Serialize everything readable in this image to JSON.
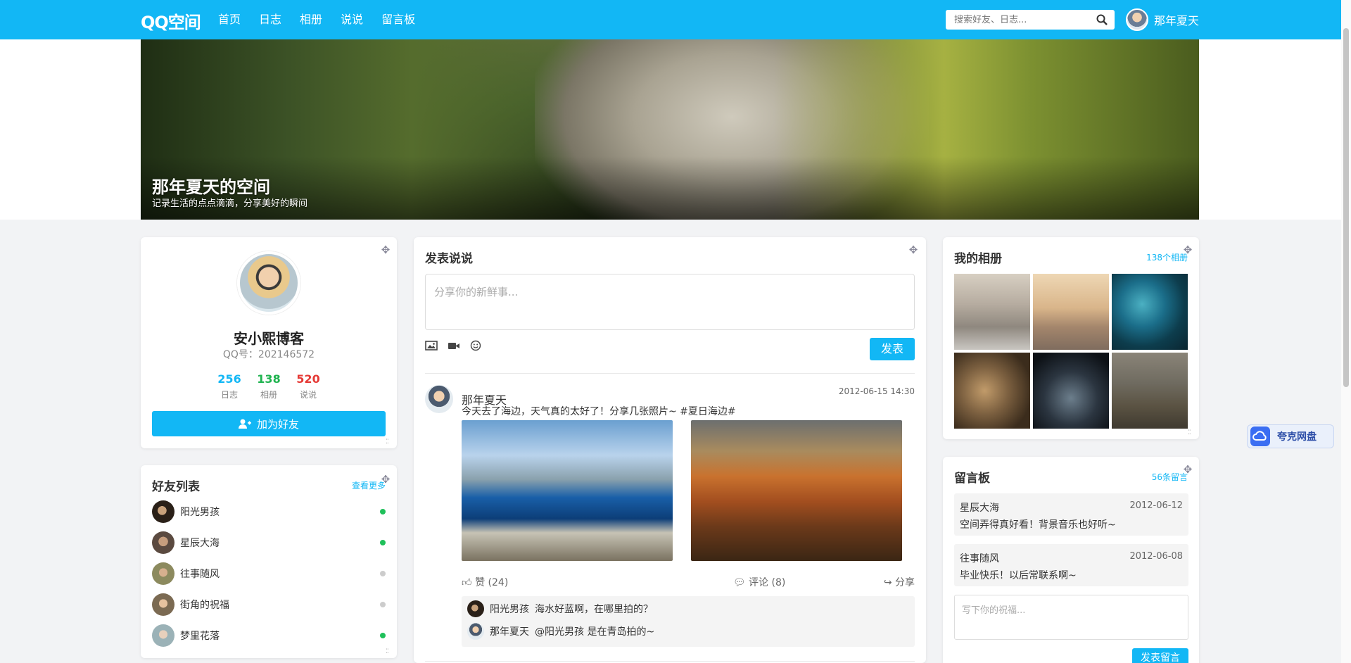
{
  "header": {
    "brand": "QQ空间",
    "nav": [
      "首页",
      "日志",
      "相册",
      "说说",
      "留言板"
    ],
    "search_placeholder": "搜索好友、日志...",
    "user_name": "那年夏天"
  },
  "banner": {
    "title": "那年夏天的空间",
    "subtitle": "记录生活的点点滴滴，分享美好的瞬间"
  },
  "profile": {
    "name": "安小熙博客",
    "qq": "QQ号：202146572",
    "stats": [
      {
        "value": "256",
        "label": "日志",
        "color": "#12b7f5"
      },
      {
        "value": "138",
        "label": "相册",
        "color": "#1fb34f"
      },
      {
        "value": "520",
        "label": "说说",
        "color": "#e53935"
      }
    ],
    "add_button": "加为好友"
  },
  "friends": {
    "title": "好友列表",
    "more": "查看更多",
    "items": [
      {
        "name": "阳光男孩",
        "online": true
      },
      {
        "name": "星辰大海",
        "online": true
      },
      {
        "name": "往事随风",
        "online": false
      },
      {
        "name": "街角的祝福",
        "online": false
      },
      {
        "name": "梦里花落",
        "online": true
      }
    ]
  },
  "post": {
    "title": "发表说说",
    "placeholder": "分享你的新鲜事...",
    "submit": "发表"
  },
  "feed": {
    "author": "那年夏天",
    "time": "2012-06-15 14:30",
    "text": "今天去了海边，天气真的太好了！分享几张照片~ #夏日海边#",
    "like": "赞 (24)",
    "comment": "评论 (8)",
    "share": "分享",
    "comments": [
      {
        "user": "阳光男孩",
        "text": "海水好蓝啊，在哪里拍的？"
      },
      {
        "user": "那年夏天",
        "text": "@阳光男孩 是在青岛拍的~"
      }
    ]
  },
  "album": {
    "title": "我的相册",
    "count": "138个相册"
  },
  "messages": {
    "title": "留言板",
    "count": "56条留言",
    "items": [
      {
        "name": "星辰大海",
        "date": "2012-06-12",
        "text": "空间弄得真好看！背景音乐也好听~"
      },
      {
        "name": "往事随风",
        "date": "2012-06-08",
        "text": "毕业快乐！以后常联系啊~"
      }
    ],
    "placeholder": "写下你的祝福...",
    "submit": "发表留言"
  },
  "floating": {
    "label": "夸克网盘"
  }
}
